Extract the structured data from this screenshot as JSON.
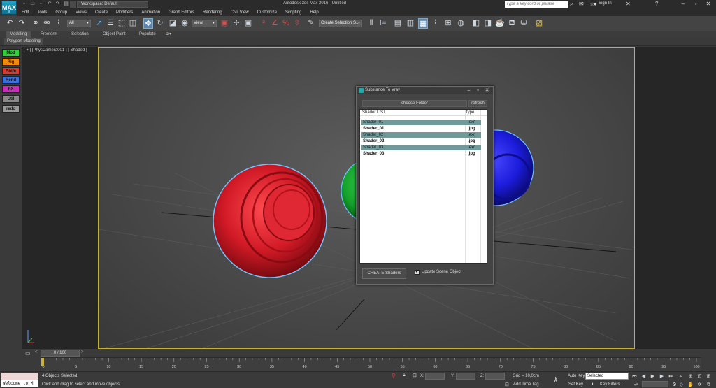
{
  "app": {
    "logo": "MAX",
    "logo_sub": "Ξ",
    "title": "Autodesk 3ds Max 2016 · Untitled",
    "workspace": "Workspace: Default",
    "search_placeholder": "Type a keyword or phrase",
    "sign_in": "Sign In"
  },
  "menu": [
    "Edit",
    "Tools",
    "Group",
    "Views",
    "Create",
    "Modifiers",
    "Animation",
    "Graph Editors",
    "Rendering",
    "Civil View",
    "Customize",
    "Scripting",
    "Help"
  ],
  "toolbar": {
    "selection_filter": "All",
    "ref_coord": "View",
    "named_selection": "Create Selection S..."
  },
  "ribbon": {
    "tabs": [
      "Modeling",
      "Freeform",
      "Selection",
      "Object Paint",
      "Populate"
    ],
    "subtab": "Polygon Modeling"
  },
  "command_panel": [
    {
      "label": "Mod",
      "color": "#2fd13a"
    },
    {
      "label": "Rig",
      "color": "#f08a10"
    },
    {
      "label": "Anim",
      "color": "#d83a2e"
    },
    {
      "label": "Rend",
      "color": "#3b6fe0"
    },
    {
      "label": "FX",
      "color": "#c62db8"
    },
    {
      "label": "Util",
      "color": "#8a8a8a"
    },
    {
      "label": "redo",
      "color": "#9a9a9a"
    }
  ],
  "viewport": {
    "label": "[ + ] [PhysCamera001 ] [ Shaded ]"
  },
  "dialog": {
    "title": "Substance To Vray",
    "choose_folder": "choose Folder",
    "refresh": "refresh",
    "list_header_name": "Shader LIST",
    "list_header_type": "type",
    "rows": [
      {
        "name": "Shader_01",
        "type": ".exr",
        "highlight": true
      },
      {
        "name": "Shader_01",
        "type": ".jpg",
        "highlight": false
      },
      {
        "name": "Shader_02",
        "type": ".exr",
        "highlight": true
      },
      {
        "name": "Shader_02",
        "type": ".jpg",
        "highlight": false
      },
      {
        "name": "Shader_03",
        "type": ".exr",
        "highlight": true
      },
      {
        "name": "Shader_03",
        "type": ".jpg",
        "highlight": false
      }
    ],
    "create_button": "CREATE  Shaders",
    "update_label": "Update Scene Object",
    "update_checked": true
  },
  "timeline": {
    "slider": "0 / 100",
    "ticks": [
      "0",
      "5",
      "10",
      "15",
      "20",
      "25",
      "30",
      "35",
      "40",
      "45",
      "50",
      "55",
      "60",
      "65",
      "70",
      "75",
      "80",
      "85",
      "90",
      "95",
      "100"
    ]
  },
  "status": {
    "maxscript": "Welcome to M",
    "selected": "4 Objects Selected",
    "prompt": "Click and drag to select and move objects",
    "x_label": "X:",
    "y_label": "Y:",
    "z_label": "Z:",
    "grid": "Grid = 10,0cm",
    "add_time_tag": "Add Time Tag",
    "auto_key": "Auto Key",
    "set_key": "Set Key",
    "selected_dd": "Selected",
    "key_filters": "Key Filters..."
  }
}
